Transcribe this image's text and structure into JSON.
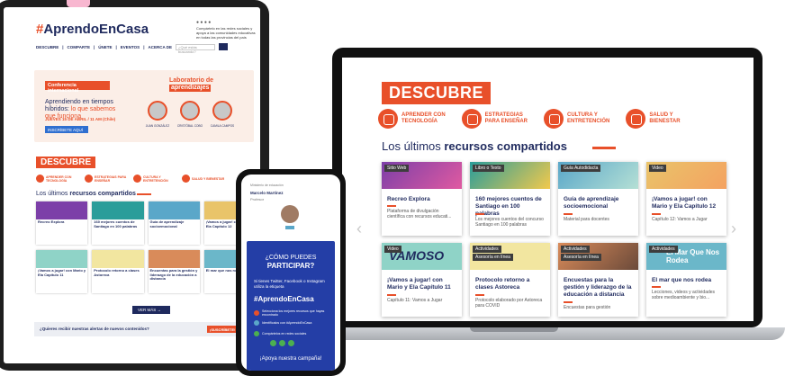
{
  "tablet": {
    "logo_hash": "#",
    "logo_text": "AprendoEnCasa",
    "tagline": "Compártelo en las redes sociales y apoya a las comunidades educativas en todas las provincias del país",
    "nav": [
      "DESCUBRE",
      "COMPARTE",
      "ÚNETE",
      "EVENTOS",
      "ACERCA DE"
    ],
    "search_placeholder": "¿Qué estás buscando?",
    "banner": {
      "tag": "Conferencia internacional",
      "lab_line1": "Laboratorio de",
      "lab_line2": "aprendizajes",
      "headline1": "Aprendiendo en tiempos híbridos:",
      "headline2": "lo que sabemos que funciona",
      "date": "JUEVES 15 DE ABRIL / 11 AM (Chile)",
      "button": "INSCRÍBETE AQUÍ →",
      "speakers": [
        "JUAN GONZÁLEZ",
        "CRISTÓBAL COBO",
        "CAMILA CAMPOS"
      ]
    },
    "descubre": "DESCUBRE",
    "cats": [
      "APRENDER CON TECNOLOGÍA",
      "ESTRATEGIAS PARA ENSEÑAR",
      "CULTURA Y ENTRETENCIÓN",
      "SALUD Y BIENESTAR"
    ],
    "recent_a": "Los últimos ",
    "recent_b": "recursos compartidos",
    "cards_row1": [
      "Recreo Explora",
      "160 mejores cuentos de Santiago en 100 palabras",
      "Guía de aprendizaje socioemocional",
      "¡Vamos a jugar! con Mario y Ela Capítulo 12"
    ],
    "cards_row2": [
      "¡Vamos a jugar! con Mario y Ela Capítulo 11",
      "Protocolo retorno a clases Astoreca",
      "Encuentas para la gestión y liderazgo de la educación a distancia",
      "El mar que nos rodea"
    ],
    "ver_mas": "VER MÁS →",
    "alert_text": "¿Quieres recibir nuestras alertas de nuevos contenidos?",
    "alert_button": "¡SUSCRÍBETE! →"
  },
  "laptop": {
    "descubre": "DESCUBRE",
    "cats": [
      {
        "l1": "APRENDER CON",
        "l2": "TECNOLOGÍA"
      },
      {
        "l1": "ESTRATEGIAS",
        "l2": "PARA ENSEÑAR"
      },
      {
        "l1": "CULTURA Y",
        "l2": "ENTRETENCIÓN"
      },
      {
        "l1": "SALUD Y",
        "l2": "BIENESTAR"
      }
    ],
    "recent_a": "Los últimos ",
    "recent_b": "recursos compartidos",
    "row1": [
      {
        "badge": "Sitio Web",
        "title": "Recreo Explora",
        "sub": "Plataforma de divulgación científica con recursos educati..."
      },
      {
        "badge": "Libro o Texto",
        "title": "160 mejores cuentos de Santiago en 100 palabras",
        "sub": "Los mejores cuentos del concurso Santiago en 100 palabras"
      },
      {
        "badge": "Guía Autodidacta",
        "title": "Guía de aprendizaje socioemocional",
        "sub": "Material para docentes"
      },
      {
        "badge": "Video",
        "title": "¡Vamos a jugar! con Mario y Ela Capítulo 12",
        "sub": "Capítulo 12: Vamos a Jugar"
      }
    ],
    "row2": [
      {
        "badge": "Video",
        "title": "¡Vamos a jugar! con Mario y Ela Capítulo 11",
        "sub": "Capítulo 11: Vamos a Jugar"
      },
      {
        "badge": "Actividades",
        "badge2": "Asesoría en línea",
        "title": "Protocolo retorno a clases Astoreca",
        "sub": "Protocolo elaborado por Astoreca para COVID"
      },
      {
        "badge": "Actividades",
        "badge2": "Asesoría en línea",
        "title": "Encuestas para la gestión y liderazgo de la educación a distancia",
        "sub": "Encuestas para gestión"
      },
      {
        "badge": "Actividades",
        "title": "El mar que nos rodea",
        "sub": "Lecciones, videos y actividades sobre medioambiente y bio..."
      }
    ],
    "img_text1": "VAMOSO",
    "img_text2": "El Mar Que Nos Rodea"
  },
  "phone": {
    "top1": "Ministerio de educación",
    "name": "Marcelo Martínez",
    "role": "Profesor",
    "q1": "¿CÓMO PUEDES",
    "q2": "PARTICIPAR?",
    "text": "Si tienes Twitter, Facebook o Instagram utiliza la etiqueta",
    "logo": "#AprendoEnCasa",
    "steps": [
      "Selecciona los mejores recursos que hayas encontrado",
      "Identifícalos con #AprendoEnCasa",
      "Compártelos en redes sociales"
    ],
    "apoya": "¡Apoya nuestra campaña!"
  }
}
